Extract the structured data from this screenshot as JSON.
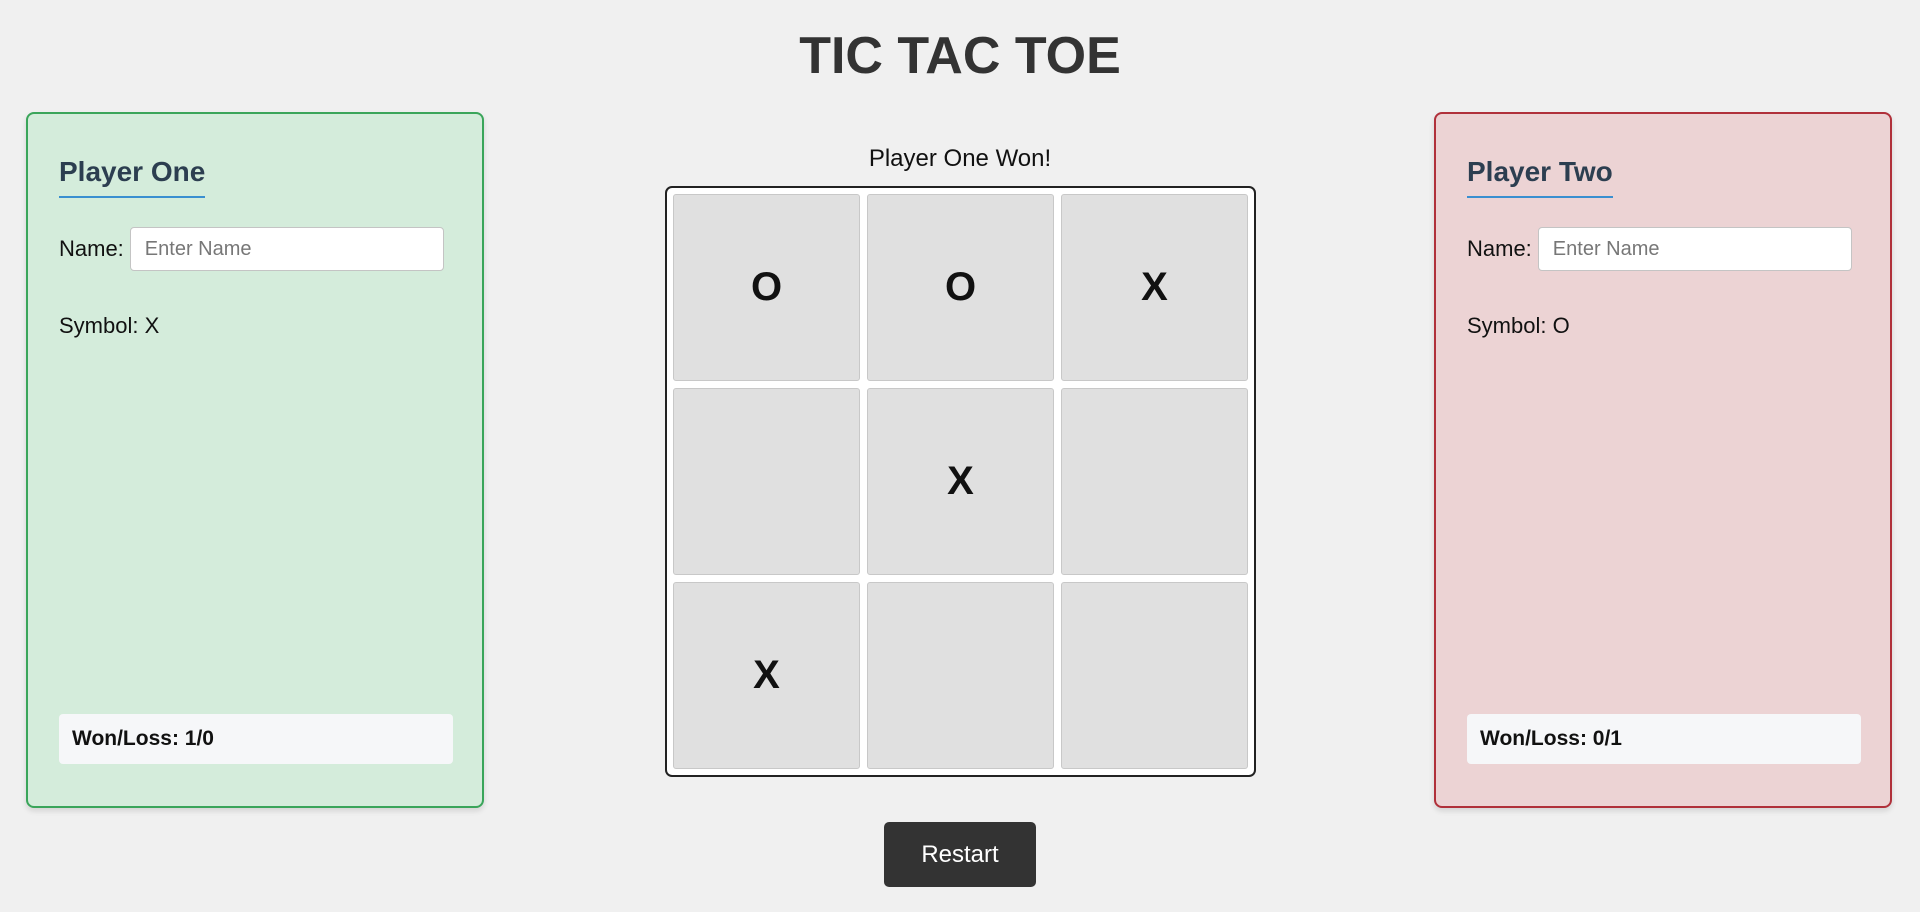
{
  "title": "TIC TAC TOE",
  "status": "Player One Won!",
  "players": [
    {
      "heading": "Player One",
      "name_label": "Name:",
      "name_placeholder": "Enter Name",
      "name_value": "",
      "symbol_text": "Symbol: X",
      "record_text": "Won/Loss: 1/0",
      "accent_color": "#3aa55a",
      "background_color": "#d4ecdb"
    },
    {
      "heading": "Player Two",
      "name_label": "Name:",
      "name_placeholder": "Enter Name",
      "name_value": "",
      "symbol_text": "Symbol: O",
      "record_text": "Won/Loss: 0/1",
      "accent_color": "#b0303a",
      "background_color": "#ecd3d4"
    }
  ],
  "board": {
    "cells": [
      "O",
      "O",
      "X",
      "",
      "X",
      "",
      "X",
      "",
      ""
    ]
  },
  "restart_label": "Restart"
}
